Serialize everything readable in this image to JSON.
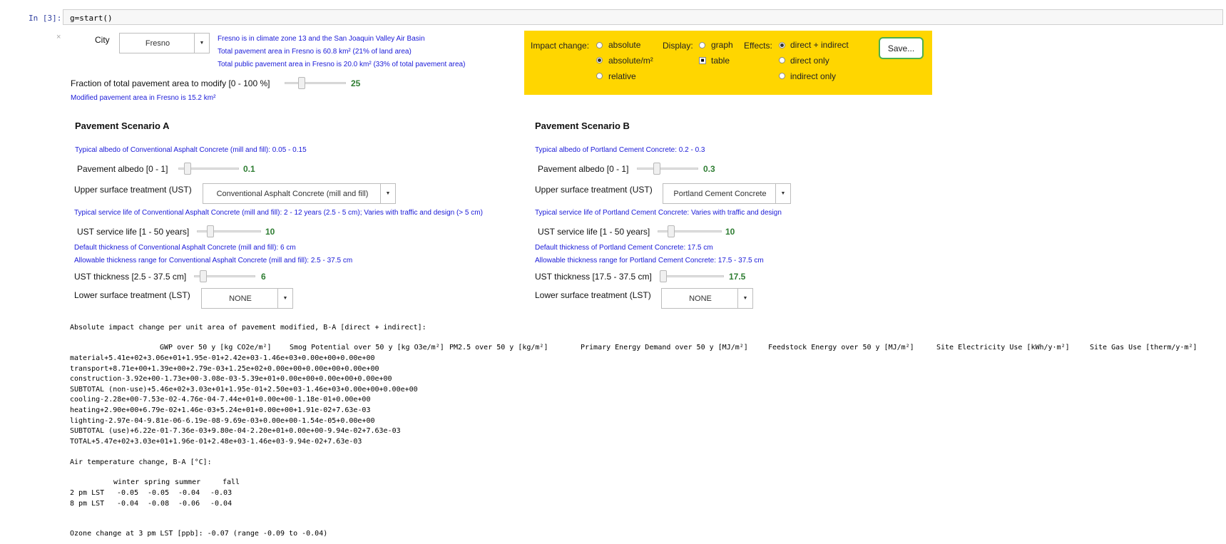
{
  "cell": {
    "prompt": "In [3]:",
    "code": "g=start()"
  },
  "close_symbol": "×",
  "city": {
    "label": "City",
    "value": "Fresno",
    "info": [
      "Fresno is in climate zone 13 and the San Joaquin Valley Air Basin",
      "Total pavement area in Fresno is 60.8 km² (21% of land area)",
      "Total public pavement area in Fresno is 20.0 km² (33% of total pavement area)"
    ]
  },
  "fraction": {
    "label": "Fraction of total pavement area to modify [0 - 100 %]",
    "value": "25",
    "level_percent": 25,
    "note": "Modified pavement area in Fresno is 15.2 km²"
  },
  "options_panel": {
    "bg_color": "#ffd600",
    "impact_change_label": "Impact change:",
    "impact_change": [
      {
        "label": "absolute",
        "selected": false
      },
      {
        "label": "absolute/m²",
        "selected": true
      },
      {
        "label": "relative",
        "selected": false
      }
    ],
    "display_label": "Display:",
    "display": [
      {
        "label": "graph",
        "checked": false
      },
      {
        "label": "table",
        "checked": true
      }
    ],
    "effects_label": "Effects:",
    "effects": [
      {
        "label": "direct + indirect",
        "selected": true
      },
      {
        "label": "direct only",
        "selected": false
      },
      {
        "label": "indirect only",
        "selected": false
      }
    ],
    "save_label": "Save..."
  },
  "scenario_a": {
    "title": "Pavement Scenario A",
    "albedo_typical": "Typical albedo of Conventional Asphalt Concrete (mill and fill): 0.05 - 0.15",
    "albedo_label": "Pavement albedo [0 - 1]",
    "albedo_value": "0.1",
    "albedo_level": 0.1,
    "ust_label": "Upper surface treatment (UST)",
    "ust_value": "Conventional Asphalt Concrete (mill and fill)",
    "service_life_typical": "Typical service life of Conventional Asphalt Concrete (mill and fill): 2 - 12 years (2.5 - 5 cm); Varies with traffic and design (> 5 cm)",
    "service_life_label": "UST service life [1 - 50 years]",
    "service_life_value": "10",
    "service_life_level": 0.18,
    "thickness_default": "Default thickness of Conventional Asphalt Concrete (mill and fill): 6 cm",
    "thickness_range": "Allowable thickness range for Conventional Asphalt Concrete (mill and fill): 2.5 - 37.5 cm",
    "thickness_label": "UST thickness [2.5 - 37.5 cm]",
    "thickness_value": "6",
    "thickness_level": 0.1,
    "lst_label": "Lower surface treatment (LST)",
    "lst_value": "NONE"
  },
  "scenario_b": {
    "title": "Pavement Scenario B",
    "albedo_typical": "Typical albedo of Portland Cement Concrete: 0.2 - 0.3",
    "albedo_label": "Pavement albedo [0 - 1]",
    "albedo_value": "0.3",
    "albedo_level": 0.3,
    "ust_label": "Upper surface treatment (UST)",
    "ust_value": "Portland Cement Concrete",
    "service_life_typical": "Typical service life of Portland Cement Concrete: Varies with traffic and design",
    "service_life_label": "UST service life [1 - 50 years]",
    "service_life_value": "10",
    "service_life_level": 0.18,
    "thickness_default": "Default thickness of Portland Cement Concrete: 17.5 cm",
    "thickness_range": "Allowable thickness range for Portland Cement Concrete: 17.5 - 37.5 cm",
    "thickness_label": "UST thickness [17.5 - 37.5 cm]",
    "thickness_value": "17.5",
    "thickness_level": 0.0,
    "lst_label": "Lower surface treatment (LST)",
    "lst_value": "NONE"
  },
  "impact_table": {
    "caption": "Absolute impact change per unit area of pavement modified, B-A [direct + indirect]:",
    "headers": [
      "GWP over 50 y [kg CO2e/m²]",
      "Smog Potential over 50 y [kg O3e/m²]",
      "PM2.5 over 50 y [kg/m²]",
      "Primary Energy Demand over 50 y [MJ/m²]",
      "Feedstock Energy over 50 y [MJ/m²]",
      "Site Electricity Use [kWh/y·m²]",
      "Site Gas Use [therm/y·m²]"
    ],
    "rows": [
      {
        "label": "material",
        "values": [
          "+5.41e+02",
          "+3.06e+01",
          "+1.95e-01",
          "+2.42e+03",
          "-1.46e+03",
          "+0.00e+00",
          "+0.00e+00"
        ]
      },
      {
        "label": "transport",
        "values": [
          "+8.71e+00",
          "+1.39e+00",
          "+2.79e-03",
          "+1.25e+02",
          "+0.00e+00",
          "+0.00e+00",
          "+0.00e+00"
        ]
      },
      {
        "label": "construction",
        "values": [
          "-3.92e+00",
          "-1.73e+00",
          "-3.08e-03",
          "-5.39e+01",
          "+0.00e+00",
          "+0.00e+00",
          "+0.00e+00"
        ]
      },
      {
        "label": "SUBTOTAL (non-use)",
        "values": [
          "+5.46e+02",
          "+3.03e+01",
          "+1.95e-01",
          "+2.50e+03",
          "-1.46e+03",
          "+0.00e+00",
          "+0.00e+00"
        ]
      },
      {
        "label": "cooling",
        "values": [
          "-2.28e+00",
          "-7.53e-02",
          "-4.76e-04",
          "-7.44e+01",
          "+0.00e+00",
          "-1.18e-01",
          "+0.00e+00"
        ]
      },
      {
        "label": "heating",
        "values": [
          "+2.90e+00",
          "+6.79e-02",
          "+1.46e-03",
          "+5.24e+01",
          "+0.00e+00",
          "+1.91e-02",
          "+7.63e-03"
        ]
      },
      {
        "label": "lighting",
        "values": [
          "-2.97e-04",
          "-9.81e-06",
          "-6.19e-08",
          "-9.69e-03",
          "+0.00e+00",
          "-1.54e-05",
          "+0.00e+00"
        ]
      },
      {
        "label": "SUBTOTAL (use)",
        "values": [
          "+6.22e-01",
          "-7.36e-03",
          "+9.80e-04",
          "-2.20e+01",
          "+0.00e+00",
          "-9.94e-02",
          "+7.63e-03"
        ]
      },
      {
        "label": "TOTAL",
        "values": [
          "+5.47e+02",
          "+3.03e+01",
          "+1.96e-01",
          "+2.48e+03",
          "-1.46e+03",
          "-9.94e-02",
          "+7.63e-03"
        ]
      }
    ]
  },
  "air_temp": {
    "caption": "Air temperature change, B-A [°C]:",
    "headers": [
      "winter",
      "spring",
      "summer",
      "fall"
    ],
    "rows": [
      {
        "label": "2 pm LST",
        "values": [
          "-0.05",
          "-0.05",
          "-0.04",
          "-0.03"
        ]
      },
      {
        "label": "8 pm LST",
        "values": [
          "-0.04",
          "-0.08",
          "-0.06",
          "-0.04"
        ]
      }
    ]
  },
  "ozone": "Ozone change at 3 pm LST [ppb]: -0.07 (range -0.09 to -0.04)"
}
